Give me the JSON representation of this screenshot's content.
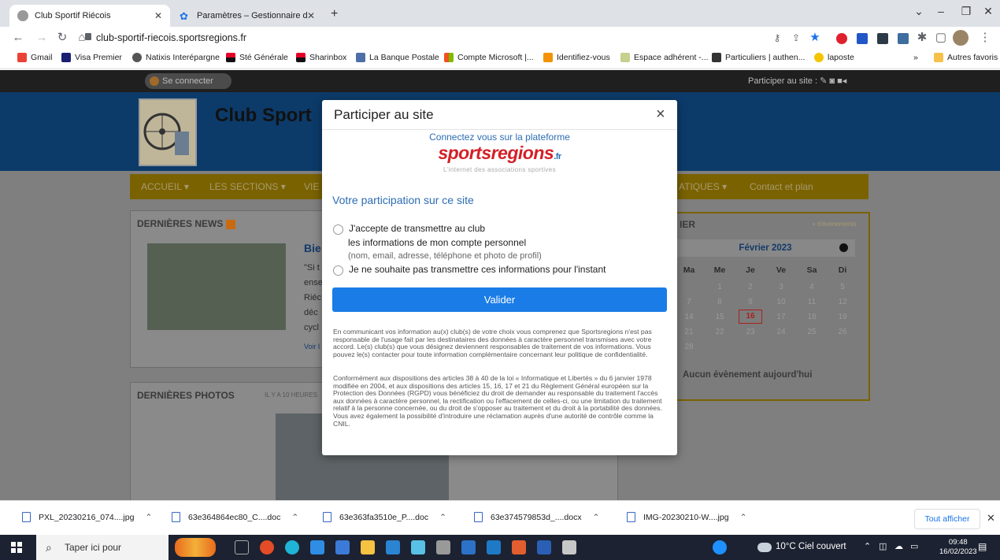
{
  "browser": {
    "tabs": [
      {
        "title": "Club Sportif Riécois",
        "active": true
      },
      {
        "title": "Paramètres – Gestionnaire de mo",
        "active": false
      }
    ],
    "new_tab": "+",
    "url": "club-sportif-riecois.sportsregions.fr",
    "bookmarks": [
      "Gmail",
      "Visa Premier",
      "Natixis Interépargne",
      "Sté Générale",
      "Sharinbox",
      "La Banque Postale",
      "Compte Microsoft |...",
      "Identifiez-vous",
      "Espace adhérent -...",
      "Particuliers | authen...",
      "laposte"
    ],
    "bookmarks_more": "»",
    "other_bookmarks": "Autres favoris"
  },
  "site": {
    "connect": "Se connecter",
    "participer": "Participer au site :",
    "club_title": "Club Sport",
    "menu": [
      "ACCUEIL ▾",
      "LES SECTIONS ▾",
      "VIE",
      "ATIQUES ▾",
      "Contact et plan"
    ],
    "news_head": "DERNIÈRES NEWS",
    "news_title": "Bie",
    "news_excerpt": [
      "\"Si t",
      "ense",
      "Riéc",
      "déc",
      "cycl"
    ],
    "news_more": "Voir l",
    "photos_head": "DERNIÈRES PHOTOS",
    "photos_time": "IL Y A 10 HEURES",
    "calendar_head": "IER",
    "calendar_more": "+ d'évènements",
    "calendar_month": "Février 2023",
    "calendar_days": [
      "Ma",
      "Me",
      "Je",
      "Ve",
      "Sa",
      "Di"
    ],
    "calendar_rows": [
      [
        "",
        "1",
        "2",
        "3",
        "4",
        "5"
      ],
      [
        "7",
        "8",
        "9",
        "10",
        "11",
        "12"
      ],
      [
        "14",
        "15",
        "16",
        "17",
        "18",
        "19"
      ],
      [
        "21",
        "22",
        "23",
        "24",
        "25",
        "26"
      ],
      [
        "28",
        "",
        "",
        "",
        "",
        ""
      ]
    ],
    "calendar_today": "16",
    "no_event": "Aucun évènement aujourd'hui"
  },
  "modal": {
    "title": "Participer au site",
    "close": "×",
    "connect_text": "Connectez vous sur la plateforme",
    "logo_text": "sportsregions",
    "logo_suffix": ".fr",
    "logo_sub": "L'internet des associations sportives",
    "heading": "Votre participation sur ce site",
    "option1_line1": "J'accepte de transmettre au club",
    "option1_line2": "les informations de mon compte personnel",
    "option1_line3": "(nom, email, adresse, téléphone et photo de profil)",
    "option2": "Je ne souhaite pas transmettre ces informations pour l'instant",
    "submit": "Valider",
    "legal1": "En communicant vos information au(x) club(s) de votre choix vous comprenez que Sportsregions n'est pas responsable de l'usage fait par les destinataires des données à caractère personnel transmises avec votre accord. Le(s) club(s) que vous désignez deviennent responsables de traitement de vos informations. Vous pouvez le(s) contacter pour toute information complémentaire concernant leur politique de confidentialité.",
    "legal2": "Conformément aux dispositions des articles 38 à 40 de la loi « Informatique et Libertés » du 6 janvier 1978 modifiée en 2004, et aux dispositions des articles 15, 16, 17 et 21 du Règlement Général européen sur la Protection des Données (RGPD) vous bénéficiez du droit de demander au responsable du traitement l'accès aux données à caractère personnel, la rectification ou l'effacement de celles-ci, ou une limitation du traitement relatif à la personne concernée, ou du droit de s'opposer au traitement et du droit à la portabilité des données. Vous avez également la possibilité d'introduire une réclamation auprès d'une autorité de contrôle comme la CNIL."
  },
  "downloads": {
    "items": [
      "PXL_20230216_074....jpg",
      "63e364864ec80_C....doc",
      "63e363fa3510e_P....doc",
      "63e374579853d_....docx",
      "IMG-20230210-W....jpg"
    ],
    "show_all": "Tout afficher"
  },
  "taskbar": {
    "search": "Taper ici pour",
    "weather": "10°C Ciel couvert",
    "time": "09:48",
    "date": "16/02/2023"
  },
  "colors": {
    "accent": "#1a7ce6",
    "link": "#2d6db3",
    "brand_red": "#d32027",
    "banner": "#0c3b6a"
  }
}
